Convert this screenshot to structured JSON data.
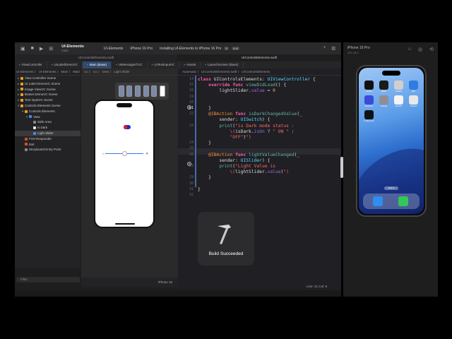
{
  "titlebar": {
    "project_name": "UI-Elements",
    "branch": "main",
    "scheme": "UI-Elements",
    "device": "iPhone 16 Pro",
    "status": "Installing UI-Elements to iPhone 16 Pro",
    "status_badge": "3",
    "warning_badge": "⚠ 6"
  },
  "filebar": {
    "left_file": "UIControlsElements.swift",
    "right_file": "UIControlsElements.swift"
  },
  "tabs": [
    {
      "label": "ViewController",
      "active": false
    },
    {
      "label": "UILabelDemoVC",
      "active": false
    },
    {
      "label": "Main (Base)",
      "active": true
    },
    {
      "label": "UIMessagesTVC",
      "active": false
    },
    {
      "label": "UITextInputVC",
      "active": false
    },
    {
      "label": "Assets",
      "active": false
    },
    {
      "label": "LaunchScreen (Base)",
      "active": false
    }
  ],
  "navigator": {
    "path": "UI-Elements 〉 UI-Elements 〉 Main 〉 Main (Base)",
    "items": [
      {
        "label": "View Controller Scene",
        "indent": 0,
        "color": "#f0a020",
        "selected": false
      },
      {
        "label": "UI Label DemoVC Scene",
        "indent": 0,
        "color": "#f0a020",
        "selected": false
      },
      {
        "label": "Image ViewVC Scene",
        "indent": 0,
        "color": "#f0a020",
        "selected": false
      },
      {
        "label": "Button DemoVC Scene",
        "indent": 0,
        "color": "#f0a020",
        "selected": false
      },
      {
        "label": "Text InputVC Scene",
        "indent": 0,
        "color": "#f0a020",
        "selected": false
      },
      {
        "label": "Controls Elements Scene",
        "indent": 0,
        "color": "#f0a020",
        "selected": false
      },
      {
        "label": "Controls Elements",
        "indent": 1,
        "color": "#f0a020",
        "selected": false
      },
      {
        "label": "View",
        "indent": 2,
        "color": "#4a8ae8",
        "selected": false
      },
      {
        "label": "Safe Area",
        "indent": 3,
        "color": "#888888",
        "selected": false
      },
      {
        "label": "is Dark",
        "indent": 3,
        "color": "#e8e8e8",
        "selected": false
      },
      {
        "label": "Light Slider",
        "indent": 3,
        "color": "#4a8ae8",
        "selected": true
      },
      {
        "label": "First Responder",
        "indent": 1,
        "color": "#e05020",
        "selected": false
      },
      {
        "label": "Exit",
        "indent": 1,
        "color": "#e05020",
        "selected": false
      },
      {
        "label": "Storyboard Entry Point",
        "indent": 1,
        "color": "#888888",
        "selected": false
      }
    ],
    "filter_placeholder": "Filter"
  },
  "canvas": {
    "path": "Co 〉 Co 〉 View 〉 Light Slider",
    "device_label": "iPhone 16",
    "slider_value": 0.5,
    "switch_on": true
  },
  "editor": {
    "path": "Automatic 〉 UIControlsElements.swift 〉 UIControlsElements",
    "position": "Line: 21  Col: 9",
    "lines": [
      {
        "n": "14",
        "html": "<span class='kw'>class</span> UIControlsElements: <span class='ty'>UIViewController</span> {"
      },
      {
        "n": "15",
        "html": "    <span class='kw'>override</span> <span class='kw'>func</span> <span class='fn'>viewDidLoad</span>() {"
      },
      {
        "n": "16",
        "html": "        lightSlider.<span class='var'>value</span> = <span class='lit'>0</span>"
      },
      {
        "n": "19",
        "html": ""
      },
      {
        "n": "20",
        "html": ""
      },
      {
        "n": "21",
        "html": "    }"
      },
      {
        "n": "22",
        "html": "    <span class='attr'>@IBAction</span> <span class='kw'>func</span> <span class='fn'>isDarkChangedValue</span>(_"
      },
      {
        "n": "",
        "html": "        sender: <span class='ty'>UISwitch</span>) {"
      },
      {
        "n": "23",
        "html": "        <span class='fn'>print</span>(<span class='str'>\"is Dark mode status :</span>"
      },
      {
        "n": "",
        "html": "<span class='str'>            \\(</span>isDark.<span class='var'>isOn</span> ? <span class='str'>\" ON \"</span> :"
      },
      {
        "n": "",
        "html": "<span class='str'>            \"OFF\"</span>)<span class='str'>\")</span>"
      },
      {
        "n": "24",
        "html": "    }"
      },
      {
        "n": "25",
        "html": ""
      },
      {
        "n": "26",
        "html": "    <span class='attr'>@IBAction</span> <span class='kw'>func</span> <span class='fn'>lightValueChanged</span>(_"
      },
      {
        "n": "",
        "html": "        sender: <span class='ty'>UISlider</span>) {"
      },
      {
        "n": "28",
        "html": "        <span class='fn'>print</span>(<span class='str'>\"Light Value is</span>"
      },
      {
        "n": "",
        "html": "<span class='str'>            \\(</span>lightSlider.<span class='var'>value</span>)<span class='str'>\")</span>"
      },
      {
        "n": "29",
        "html": "    }"
      },
      {
        "n": "30",
        "html": ""
      },
      {
        "n": "31",
        "html": "}"
      },
      {
        "n": "32",
        "html": ""
      }
    ]
  },
  "toast": {
    "label": "Build Succeeded"
  },
  "simulator": {
    "title": "iPhone 16 Pro",
    "os": "iOS 18.0",
    "apps": [
      {
        "name": "Fitness",
        "color": "#111111"
      },
      {
        "name": "Watch",
        "color": "#1a1a1a"
      },
      {
        "name": "Contacts",
        "color": "#cfcfcf"
      },
      {
        "name": "Files",
        "color": "#2f7de1"
      },
      {
        "name": "Shortcuts",
        "color": "#3a4bd8"
      },
      {
        "name": "Settings",
        "color": "#8e8e93"
      },
      {
        "name": "Freeform",
        "color": "#f4f4f4"
      },
      {
        "name": "Preview",
        "color": "#e8e8e8"
      },
      {
        "name": "UI-Elements",
        "color": "#111111"
      }
    ],
    "search_label": "Search",
    "dock": [
      {
        "name": "Safari",
        "color": "#2f8cf0"
      },
      {
        "name": "Messages",
        "color": "#34c759"
      }
    ]
  }
}
